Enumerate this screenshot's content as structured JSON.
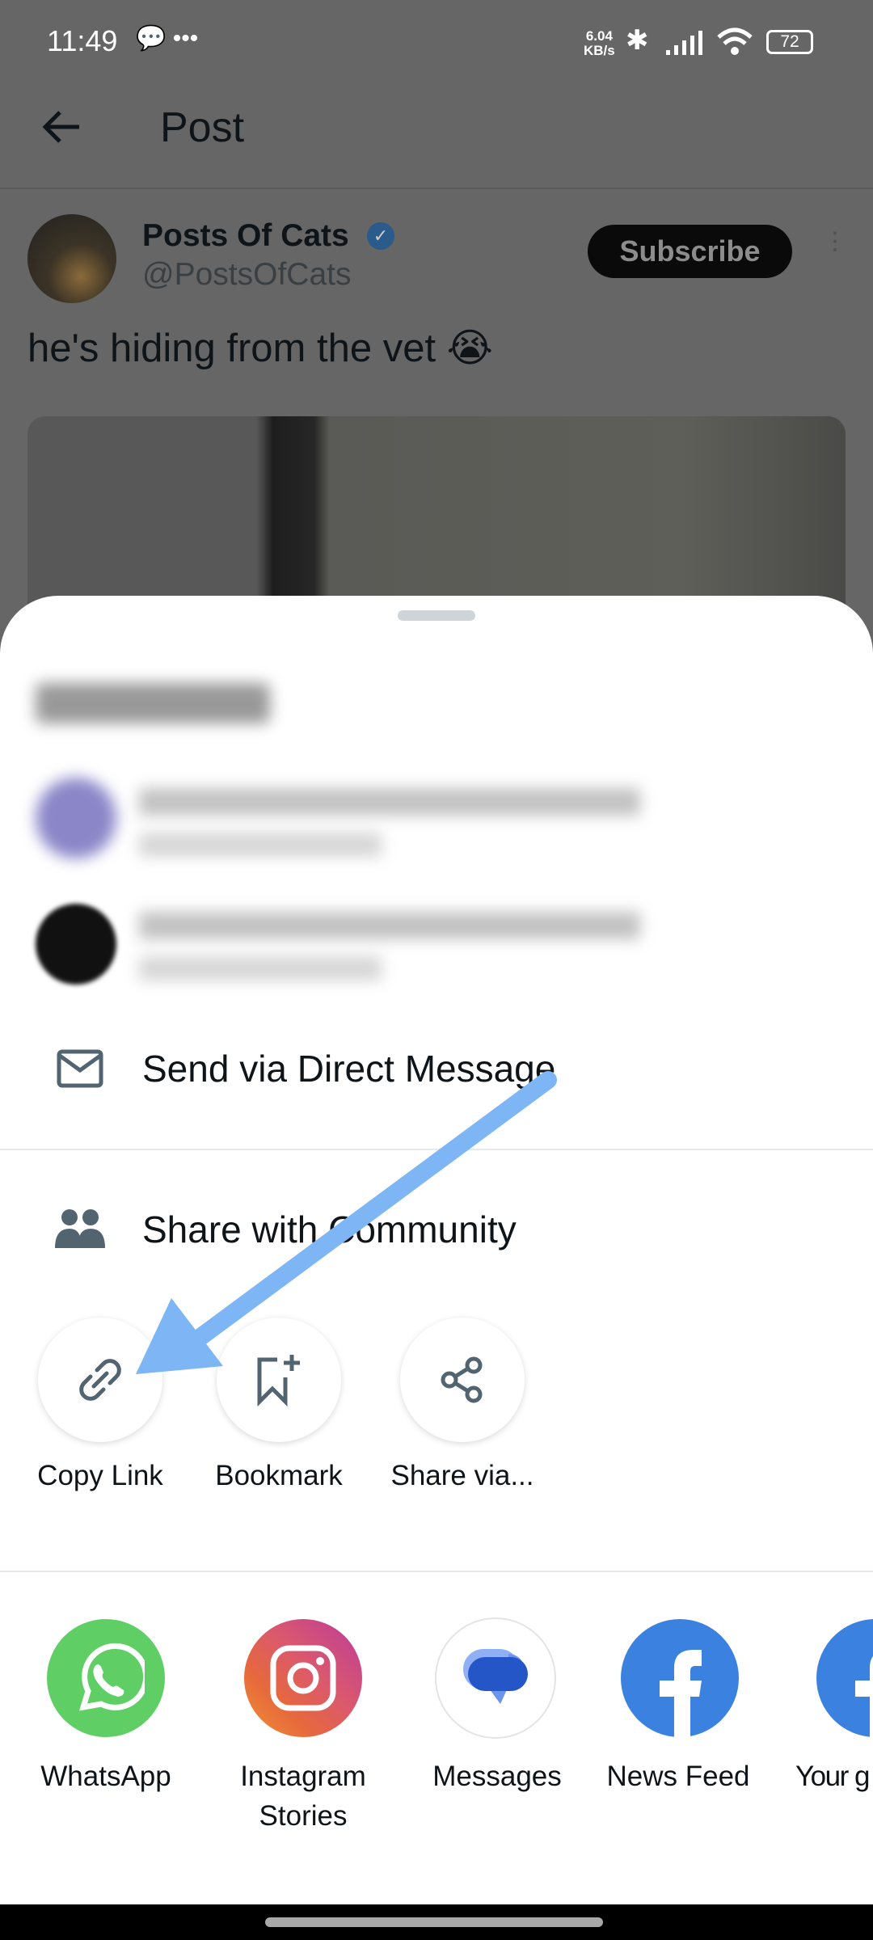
{
  "status_bar": {
    "time": "11:49",
    "net_speed": "6.04",
    "net_unit": "KB/s",
    "battery": "72"
  },
  "header": {
    "title": "Post"
  },
  "post": {
    "author": "Posts Of Cats",
    "handle": "@PostsOfCats",
    "subscribe_label": "Subscribe",
    "text": "he's hiding from the vet 😭"
  },
  "sheet": {
    "send_dm": "Send via Direct Message",
    "share_community": "Share with Community",
    "actions": [
      {
        "label": "Copy Link",
        "icon": "link-icon"
      },
      {
        "label": "Bookmark",
        "icon": "bookmark-add-icon"
      },
      {
        "label": "Share via...",
        "icon": "share-icon"
      }
    ],
    "apps": [
      {
        "label": "WhatsApp",
        "color": "#5fcf65"
      },
      {
        "label": "Instagram Stories",
        "line1": "Instagram",
        "line2": "Stories",
        "color": "#d6457a"
      },
      {
        "label": "Messages",
        "color": "#2456c8"
      },
      {
        "label": "News Feed",
        "color": "#3b82e0"
      },
      {
        "label": "Your g",
        "color": "#3b82e0"
      }
    ]
  },
  "annotation": {
    "arrow_color": "#7db5f5"
  }
}
